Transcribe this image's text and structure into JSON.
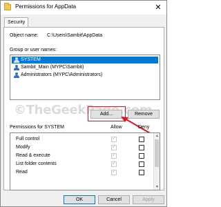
{
  "window": {
    "title": "Permissions for AppData",
    "close_glyph": "✕",
    "accent_color": "#0078d7"
  },
  "tabs": [
    {
      "label": "Security",
      "active": true
    }
  ],
  "object": {
    "label": "Object name:",
    "value": "C:\\Users\\Sambit\\AppData"
  },
  "groups": {
    "label": "Group or user names:",
    "items": [
      {
        "label": "SYSTEM",
        "icon": "user-group-icon",
        "selected": true
      },
      {
        "label": "Sambit_Main (MYPC\\Sambit)",
        "icon": "user-icon",
        "selected": false
      },
      {
        "label": "Administrators (MYPC\\Administrators)",
        "icon": "user-group-icon",
        "selected": false
      }
    ]
  },
  "watermark": "©TheGeekPage.com",
  "buttons": {
    "add": "Add...",
    "remove": "Remove"
  },
  "permissions": {
    "header": "Permissions for SYSTEM",
    "allow_label": "Allow",
    "deny_label": "Deny",
    "rows": [
      {
        "name": "Full control",
        "allow": true,
        "deny": false
      },
      {
        "name": "Modify",
        "allow": true,
        "deny": false
      },
      {
        "name": "Read & execute",
        "allow": true,
        "deny": false
      },
      {
        "name": "List folder contents",
        "allow": true,
        "deny": false
      },
      {
        "name": "Read",
        "allow": true,
        "deny": false
      }
    ]
  },
  "footer": {
    "ok": "OK",
    "cancel": "Cancel",
    "apply": "Apply"
  },
  "annotation": {
    "highlight_color": "#e81123"
  }
}
